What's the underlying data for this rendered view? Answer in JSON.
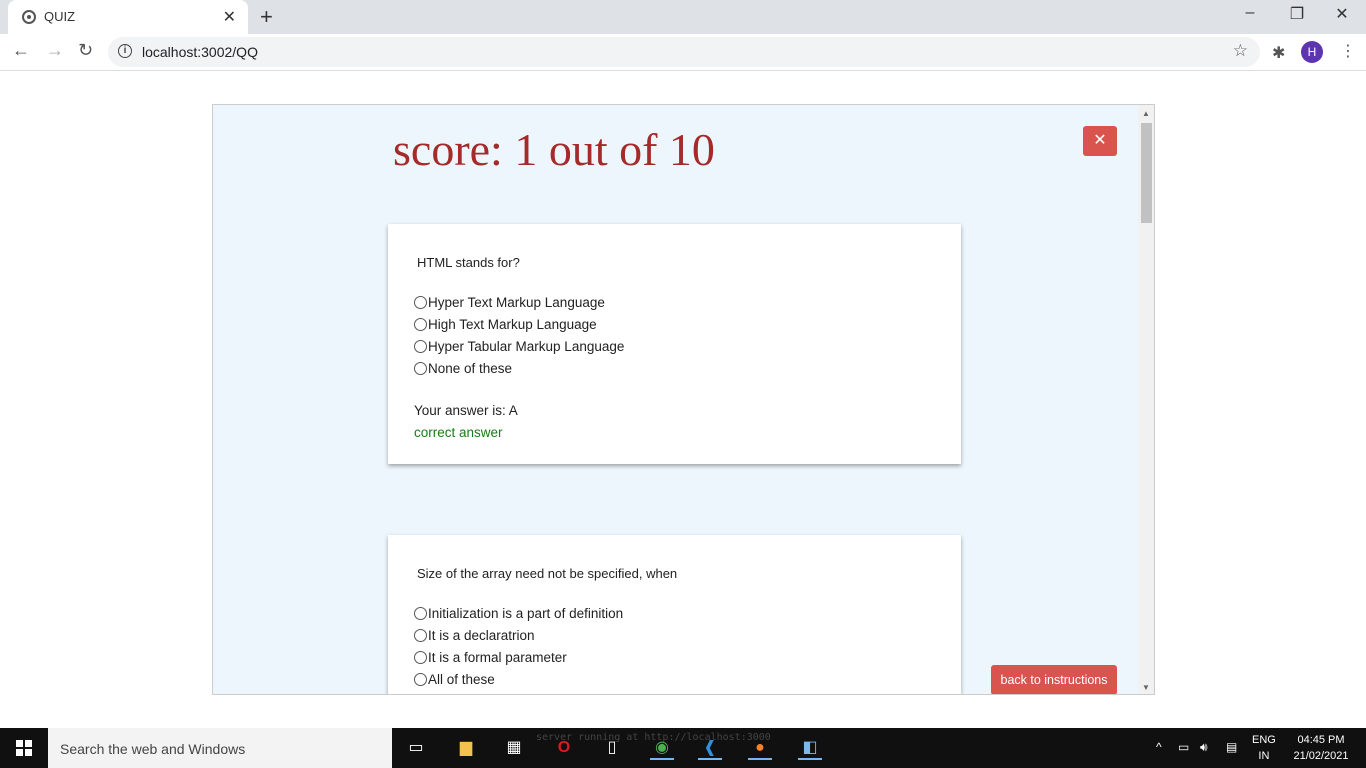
{
  "browser": {
    "tab_title": "QUIZ",
    "tab_close": "✕",
    "new_tab": "+",
    "url": "localhost:3002/QQ",
    "avatar_letter": "H",
    "minimize": "–",
    "restore": "❐",
    "close": "✕"
  },
  "quiz": {
    "score": "score: 1 out of 10",
    "close_label": "✕",
    "back_label": "back to instructions",
    "questions": [
      {
        "text": "HTML stands for?",
        "options": [
          "Hyper Text Markup Language",
          "High Text Markup Language",
          "Hyper Tabular Markup Language",
          "None of these"
        ],
        "your_answer": "Your answer is: A",
        "verdict": "correct answer"
      },
      {
        "text": "Size of the array need not be specified, when",
        "options": [
          "Initialization is a part of definition",
          "It is a declaratrion",
          "It is a formal parameter",
          "All of these"
        ]
      }
    ]
  },
  "taskbar": {
    "search_placeholder": "Search the web and Windows",
    "server_text": "server running at http://localhost:3000",
    "lang_line1": "ENG",
    "lang_line2": "IN",
    "time": "04:45 PM",
    "date": "21/02/2021"
  }
}
